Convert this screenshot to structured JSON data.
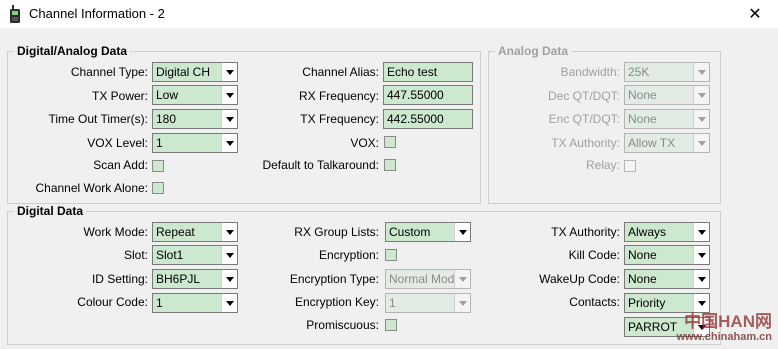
{
  "window": {
    "title": "Channel Information - 2",
    "close_glyph": "✕"
  },
  "digital_analog": {
    "title": "Digital/Analog Data",
    "channel_type_label": "Channel Type:",
    "channel_type_value": "Digital CH",
    "tx_power_label": "TX Power:",
    "tx_power_value": "Low",
    "tot_label": "Time Out Timer(s):",
    "tot_value": "180",
    "vox_level_label": "VOX Level:",
    "vox_level_value": "1",
    "scan_add_label": "Scan Add:",
    "work_alone_label": "Channel Work Alone:",
    "alias_label": "Channel Alias:",
    "alias_value": "Echo test",
    "rx_freq_label": "RX Frequency:",
    "rx_freq_value": "447.55000",
    "tx_freq_label": "TX Frequency:",
    "tx_freq_value": "442.55000",
    "vox_label": "VOX:",
    "talkaround_label": "Default to Talkaround:"
  },
  "analog": {
    "title": "Analog Data",
    "bandwidth_label": "Bandwidth:",
    "bandwidth_value": "25K",
    "dec_label": "Dec QT/DQT:",
    "dec_value": "None",
    "enc_label": "Enc QT/DQT:",
    "enc_value": "None",
    "tx_auth_label": "TX Authority:",
    "tx_auth_value": "Allow TX",
    "relay_label": "Relay:"
  },
  "digital": {
    "title": "Digital Data",
    "work_mode_label": "Work Mode:",
    "work_mode_value": "Repeat",
    "slot_label": "Slot:",
    "slot_value": "Slot1",
    "id_setting_label": "ID Setting:",
    "id_setting_value": "BH6PJL",
    "colour_code_label": "Colour Code:",
    "colour_code_value": "1",
    "rx_group_label": "RX Group Lists:",
    "rx_group_value": "Custom",
    "encryption_label": "Encryption:",
    "enc_type_label": "Encryption Type:",
    "enc_type_value": "Normal Mode",
    "enc_key_label": "Encryption Key:",
    "enc_key_value": "1",
    "promiscuous_label": "Promiscuous:",
    "tx_auth_label": "TX Authority:",
    "tx_auth_value": "Always",
    "kill_code_label": "Kill Code:",
    "kill_code_value": "None",
    "wakeup_label": "WakeUp Code:",
    "wakeup_value": "None",
    "contacts_label": "Contacts:",
    "contacts_value": "Priority",
    "contact_name_value": "PARROT"
  },
  "watermark": {
    "top": "中国HAN网",
    "bottom": "www.chinaham.cn"
  }
}
